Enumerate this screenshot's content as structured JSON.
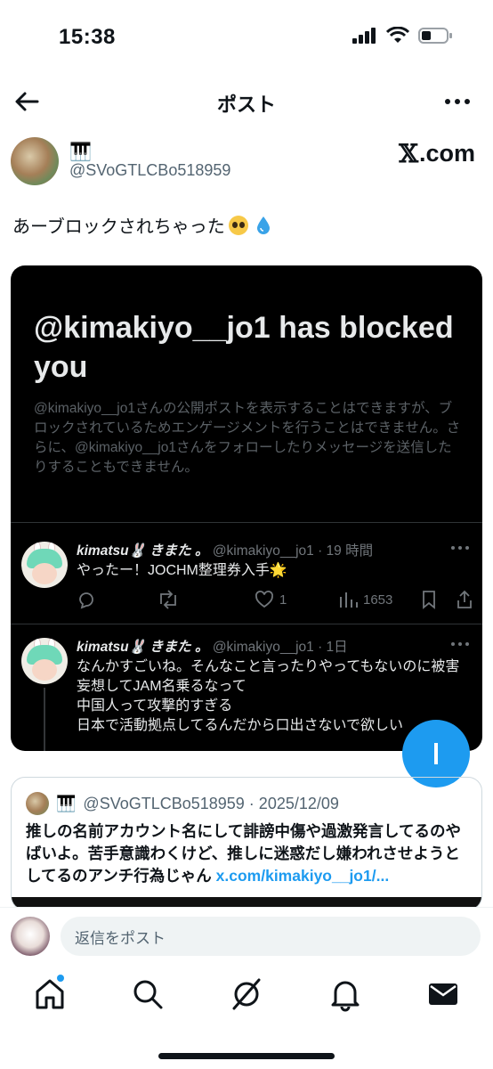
{
  "status_bar": {
    "time": "15:38"
  },
  "nav": {
    "title": "ポスト"
  },
  "author": {
    "display_name": "🎹",
    "handle": "@SVoGTLCBo518959",
    "source_label": ".com"
  },
  "post": {
    "text": "あーブロックされちゃった"
  },
  "screenshot": {
    "title": "@kimakiyo__jo1 has blocked you",
    "description": "@kimakiyo__jo1さんの公開ポストを表示することはできますが、ブロックされているためエンゲージメントを行うことはできません。さらに、@kimakiyo__jo1さんをフォローしたりメッセージを送信したりすることもできません。",
    "tweets": [
      {
        "name": "kimatsu🐰 きまた 。",
        "meta": "@kimakiyo__jo1 · 19 時間",
        "body": "やったー！JOCHM整理券入手🌟",
        "likes": "1",
        "views": "1653"
      },
      {
        "name": "kimatsu🐰 きまた 。",
        "meta": "@kimakiyo__jo1 · 1日",
        "body_lines": [
          "なんかすごいね。そんなこと言ったりやってもないのに被害妄想してJAM名乗るなって",
          "中国人って攻撃的すぎる",
          "日本で活動拠点してるんだから口出さないで欲しい"
        ]
      }
    ]
  },
  "quote": {
    "name": "🎹",
    "handle_date": "@SVoGTLCBo518959 · 2025/12/09",
    "text": "推しの名前アカウント名にして誹謗中傷や過激発言してるのやばいよ。苦手意識わくけど、推しに迷惑だし嫌われさせようとしてるのアンチ行為じゃん ",
    "link": "x.com/kimakiyo__jo1/..."
  },
  "reply": {
    "placeholder": "返信をポスト"
  },
  "tabs": [
    "home-icon",
    "search-icon",
    "grok-icon",
    "notifications-icon",
    "messages-icon"
  ],
  "colors": {
    "accent": "#1d9bf0",
    "text": "#0f1419",
    "muted": "#536471",
    "dark_bg": "#000000"
  }
}
